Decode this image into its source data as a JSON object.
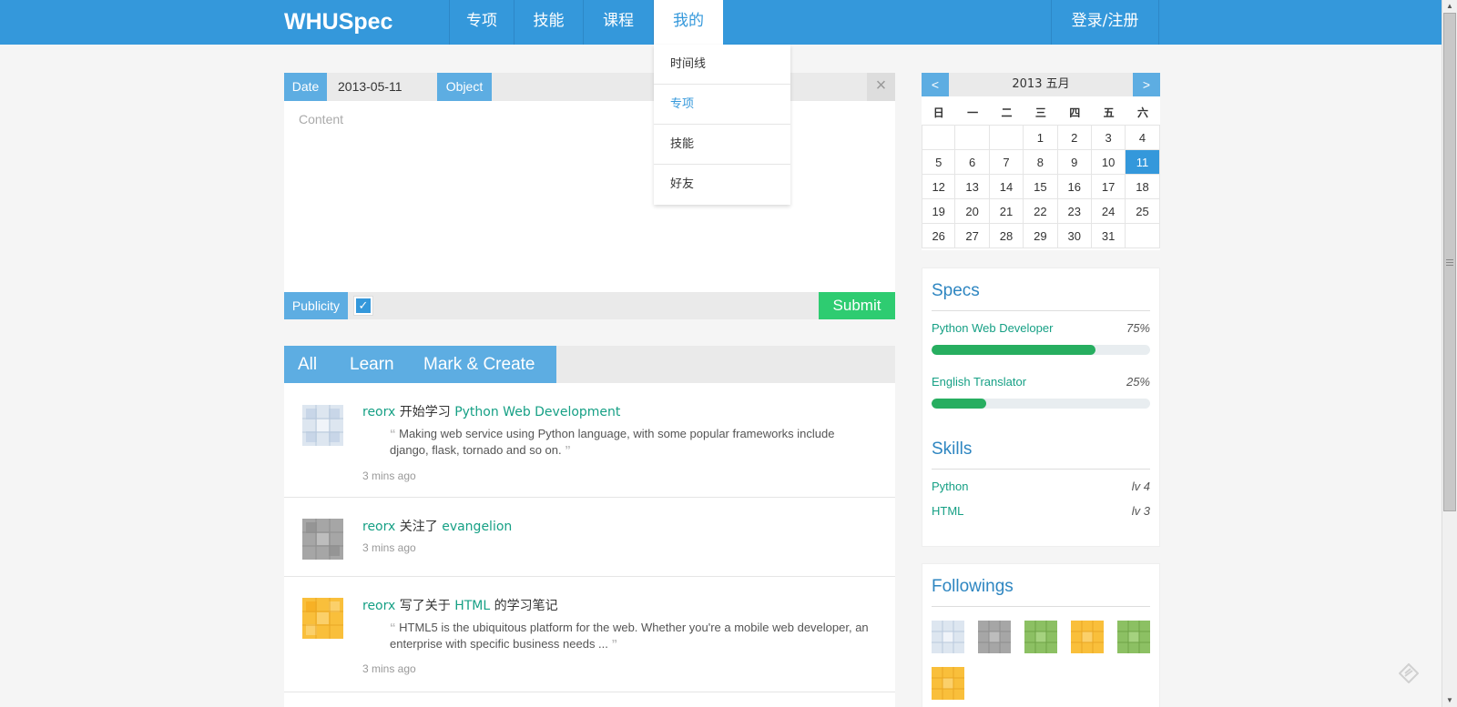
{
  "nav": {
    "brand": "WHUSpec",
    "items": [
      "专项",
      "技能",
      "课程",
      "我的"
    ],
    "login": "登录/注册"
  },
  "dropdown": {
    "items": [
      "时间线",
      "专项",
      "技能",
      "好友"
    ]
  },
  "post_form": {
    "date_label": "Date",
    "date_value": "2013-05-11",
    "object_label": "Object",
    "close": "×",
    "content_placeholder": "Content",
    "publicity_label": "Publicity",
    "checked": "✓",
    "submit": "Submit"
  },
  "feed": {
    "tabs": [
      "All",
      "Learn",
      "Mark & Create"
    ],
    "items": [
      {
        "user": "reorx",
        "action": " 开始学习 ",
        "target": "Python Web Development",
        "suffix": "",
        "quote": "Making web service using Python language, with some popular frameworks include django, flask, tornado and so on.",
        "time": "3 mins ago"
      },
      {
        "user": "reorx",
        "action": " 关注了 ",
        "target": "evangelion",
        "suffix": "",
        "quote": "",
        "time": "3 mins ago"
      },
      {
        "user": "reorx",
        "action": " 写了关于 ",
        "target": "HTML",
        "suffix": " 的学习笔记",
        "quote": "HTML5 is the ubiquitous platform for the web. Whether you're a mobile web developer, an enterprise with specific business needs ...",
        "time": "3 mins ago"
      }
    ]
  },
  "calendar": {
    "prev": "<",
    "next": ">",
    "title": "2013 五月",
    "dow": [
      "日",
      "一",
      "二",
      "三",
      "四",
      "五",
      "六"
    ],
    "weeks": [
      [
        "",
        "",
        "",
        "1",
        "2",
        "3",
        "4"
      ],
      [
        "5",
        "6",
        "7",
        "8",
        "9",
        "10",
        "11"
      ],
      [
        "12",
        "13",
        "14",
        "15",
        "16",
        "17",
        "18"
      ],
      [
        "19",
        "20",
        "21",
        "22",
        "23",
        "24",
        "25"
      ],
      [
        "26",
        "27",
        "28",
        "29",
        "30",
        "31",
        ""
      ]
    ],
    "selected": "11"
  },
  "specs": {
    "title": "Specs",
    "items": [
      {
        "name": "Python Web Developer",
        "percent_label": "75%",
        "progress": 0.75
      },
      {
        "name": "English Translator",
        "percent_label": "25%",
        "progress": 0.25
      }
    ]
  },
  "skills": {
    "title": "Skills",
    "items": [
      {
        "name": "Python",
        "level": "lv 4"
      },
      {
        "name": "HTML",
        "level": "lv 3"
      }
    ]
  },
  "followings": {
    "title": "Followings",
    "avatars": [
      "blue",
      "gray",
      "green",
      "yellow",
      "green",
      "yellow"
    ]
  },
  "colors": {
    "primary": "#3498db",
    "accent_green": "#2ecc71",
    "link_green": "#16a085",
    "avatar_blue": "#dde6f0",
    "avatar_gray": "#a6a6a6",
    "avatar_green": "#8cc063",
    "avatar_yellow": "#f9bf3b"
  }
}
